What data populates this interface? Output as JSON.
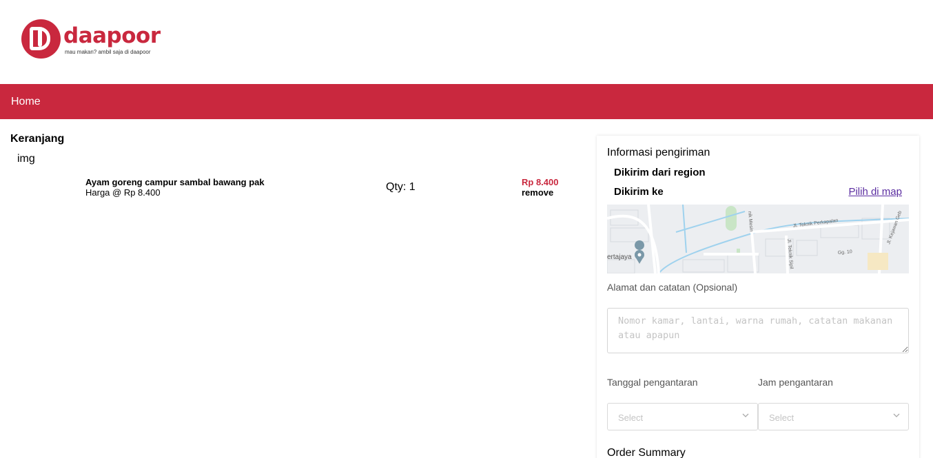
{
  "brand": {
    "name": "daapoor",
    "tagline": "mau makan? ambil saja di daapoor",
    "color": "#c9283e"
  },
  "nav": {
    "home_label": "Home"
  },
  "cart": {
    "title": "Keranjang",
    "image_alt": "img",
    "items": [
      {
        "name": "Ayam goreng campur sambal bawang pak",
        "unit_price": "Harga @ Rp 8.400",
        "qty": "Qty: 1",
        "total": "Rp 8.400",
        "remove_label": "remove"
      }
    ]
  },
  "shipping": {
    "title": "Informasi pengiriman",
    "from_label": "Dikirim dari region",
    "to_label": "Dikirim ke",
    "map_link": "Pilih di map",
    "map_labels": [
      "Jl. Teknik Perkapalan",
      "Jl. Kejawan Geb",
      "Jl. Teknik Sipil",
      "ertajaya",
      "nik Mesin",
      "Gg. 10"
    ],
    "notes_label": "Alamat dan catatan (Opsional)",
    "notes_placeholder": "Nomor kamar, lantai, warna rumah, catatan makanan atau apapun",
    "notes_value": "",
    "date_label": "Tanggal pengantaran",
    "date_placeholder": "Select",
    "time_label": "Jam pengantaran",
    "time_placeholder": "Select"
  },
  "summary": {
    "title": "Order Summary"
  }
}
